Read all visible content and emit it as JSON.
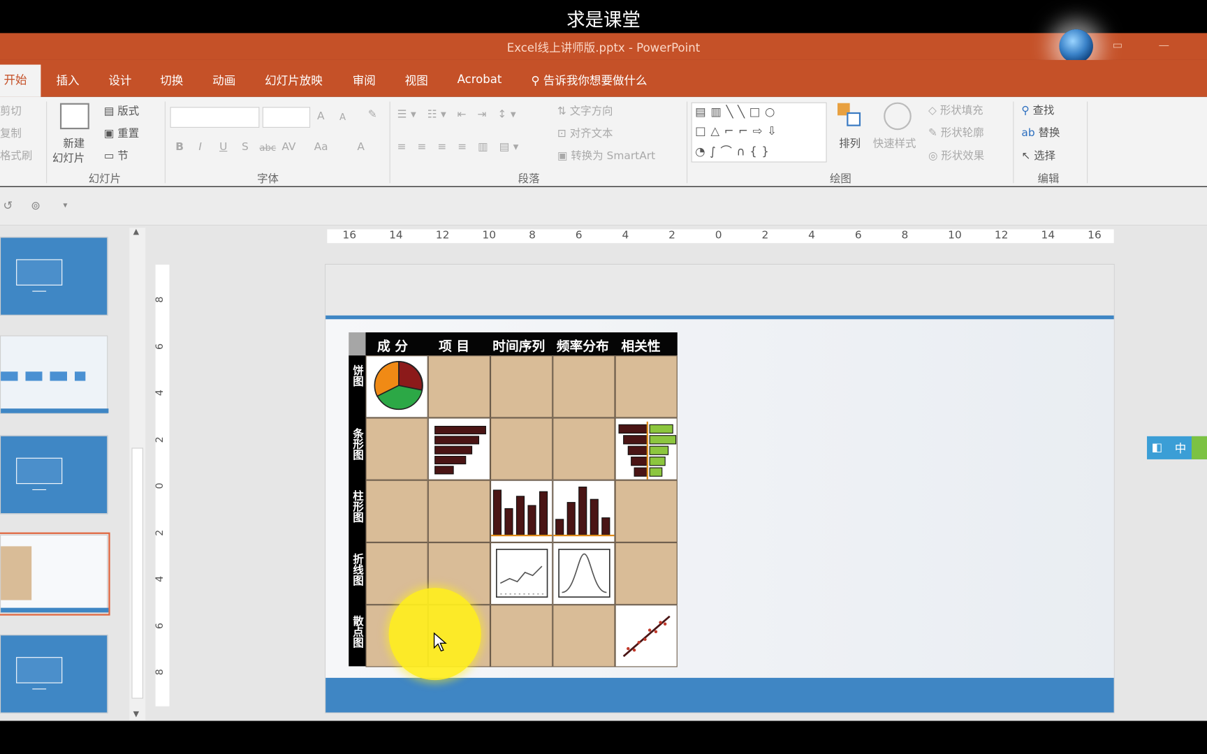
{
  "watermark": "求是课堂",
  "window": {
    "title": "Excel线上讲师版.pptx  -  PowerPoint"
  },
  "tabs": [
    "开始",
    "插入",
    "设计",
    "切换",
    "动画",
    "幻灯片放映",
    "审阅",
    "视图",
    "Acrobat"
  ],
  "tell_me": "告诉我你想要做什么",
  "clipboard": {
    "cut": "剪切",
    "copy": "复制",
    "format_painter": "格式刷"
  },
  "slides_group": {
    "new_slide_line1": "新建",
    "new_slide_line2": "幻灯片",
    "layout": "版式",
    "reset": "重置",
    "section": "节",
    "label": "幻灯片"
  },
  "font_group": {
    "label": "字体",
    "bold": "B",
    "italic": "I",
    "underline": "U",
    "shadow": "S",
    "strike": "abc",
    "spacing": "AV",
    "case": "Aa",
    "color": "A",
    "grow": "A",
    "shrink": "A"
  },
  "paragraph_group": {
    "label": "段落",
    "text_direction": "文字方向",
    "align_text": "对齐文本",
    "smartart": "转换为 SmartArt"
  },
  "drawing_group": {
    "label": "绘图",
    "arrange": "排列",
    "quick_styles": "快速样式",
    "fill": "形状填充",
    "outline": "形状轮廓",
    "effects": "形状效果"
  },
  "editing_group": {
    "label": "编辑",
    "find": "查找",
    "replace": "替换",
    "select": "选择"
  },
  "ruler": {
    "h_ticks": [
      "16",
      "14",
      "12",
      "10",
      "8",
      "6",
      "4",
      "2",
      "0",
      "2",
      "4",
      "6",
      "8",
      "10",
      "12",
      "14",
      "16"
    ],
    "v_ticks": [
      "8",
      "6",
      "4",
      "2",
      "0",
      "2",
      "4",
      "6",
      "8"
    ]
  },
  "slide_table": {
    "headers": [
      "成 分",
      "项 目",
      "时间序列",
      "频率分布",
      "相关性"
    ],
    "rows": [
      {
        "label": "饼图"
      },
      {
        "label": "条形图"
      },
      {
        "label": "柱形图"
      },
      {
        "label": "折线图"
      },
      {
        "label": "散点图"
      }
    ]
  },
  "ime": {
    "mode": "中"
  },
  "colors": {
    "ribbon_orange": "#c55128",
    "slide_blue": "#3f86c4",
    "cell_tan": "#d9bc97",
    "bar_dark": "#4a1515",
    "bar_green": "#8cc63e"
  },
  "icons": [
    "undo-icon",
    "start-from-beginning-icon",
    "customize-qat-icon",
    "lightbulb-icon",
    "find-icon",
    "replace-icon",
    "select-icon",
    "arrange-icon",
    "quick-styles-icon",
    "globe-icon",
    "mouse-pointer-icon"
  ]
}
